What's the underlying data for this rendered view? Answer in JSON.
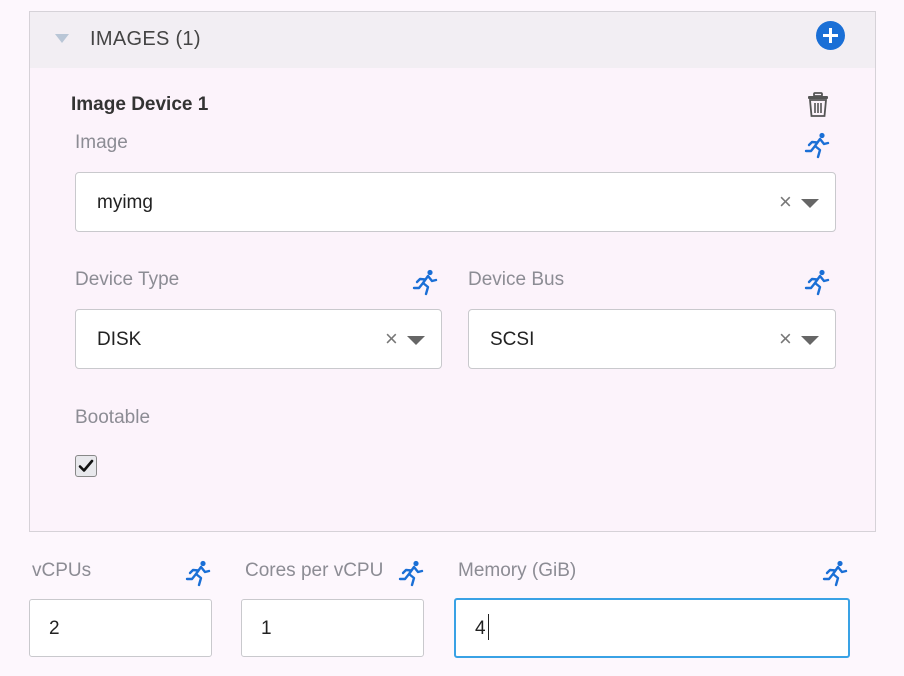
{
  "images_panel": {
    "title": "IMAGES (1)",
    "add_icon": "plus-circle-icon",
    "device": {
      "title": "Image Device 1",
      "delete_icon": "trash-icon",
      "image": {
        "label": "Image",
        "value": "myimg",
        "clear": "×"
      },
      "device_type": {
        "label": "Device Type",
        "value": "DISK",
        "clear": "×"
      },
      "device_bus": {
        "label": "Device Bus",
        "value": "SCSI",
        "clear": "×"
      },
      "bootable": {
        "label": "Bootable",
        "checked": true
      }
    }
  },
  "resources": {
    "vcpus": {
      "label": "vCPUs",
      "value": "2"
    },
    "cores": {
      "label": "Cores per vCPU",
      "value": "1"
    },
    "memory": {
      "label": "Memory (GiB)",
      "value": "4"
    }
  },
  "colors": {
    "accent_blue": "#1a6fd6",
    "focus_border": "#39a2e5",
    "label_gray": "#8c8c94"
  },
  "runtime_icon": "running-man-icon"
}
